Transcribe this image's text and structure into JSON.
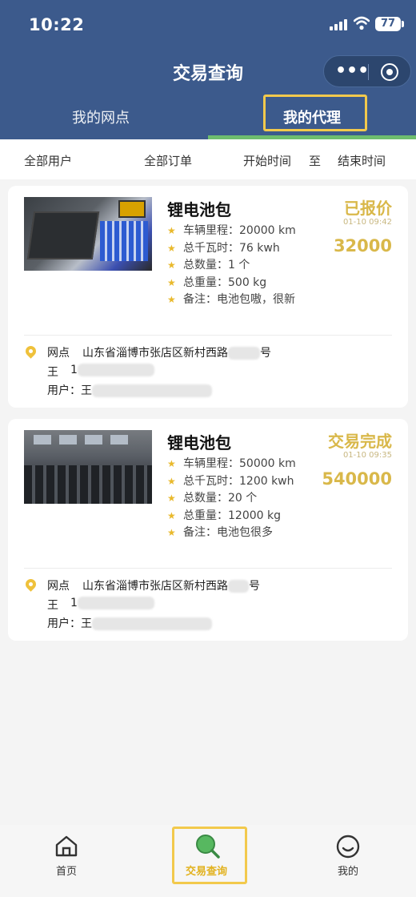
{
  "status_bar": {
    "time": "10:22",
    "battery": "77"
  },
  "nav": {
    "title": "交易查询"
  },
  "tabs": [
    {
      "label": "我的网点"
    },
    {
      "label": "我的代理"
    }
  ],
  "filters": {
    "all_users": "全部用户",
    "all_orders": "全部订单",
    "start_time": "开始时间",
    "to": "至",
    "end_time": "结束时间"
  },
  "orders": [
    {
      "title": "锂电池包",
      "status": "已报价",
      "date": "01-10 09:42",
      "price": "32000",
      "specs": [
        "车辆里程：20000 km",
        "总千瓦时：76 kwh",
        "总数量：1 个",
        "总重量：500 kg",
        "备注：电池包嗷，很新"
      ],
      "outlet_label": "网点",
      "outlet_address": "山东省淄博市张店区新村西路",
      "outlet_suffix": "号",
      "contact_name": "王",
      "contact_phone": "1",
      "user_label": "用户：",
      "user_name": "王"
    },
    {
      "title": "锂电池包",
      "status": "交易完成",
      "date": "01-10 09:35",
      "price": "540000",
      "specs": [
        "车辆里程：50000 km",
        "总千瓦时：1200 kwh",
        "总数量：20 个",
        "总重量：12000 kg",
        "备注：电池包很多"
      ],
      "outlet_label": "网点",
      "outlet_address": "山东省淄博市张店区新村西路",
      "outlet_suffix": "号",
      "contact_name": "王",
      "contact_phone": "1",
      "user_label": "用户：",
      "user_name": "王"
    }
  ],
  "bottom_nav": {
    "home": "首页",
    "query": "交易查询",
    "mine": "我的"
  },
  "colors": {
    "header": "#3c5a8c",
    "accent": "#d9b84a",
    "highlight": "#f2c94c",
    "tab_underline": "#6ebd6e"
  }
}
